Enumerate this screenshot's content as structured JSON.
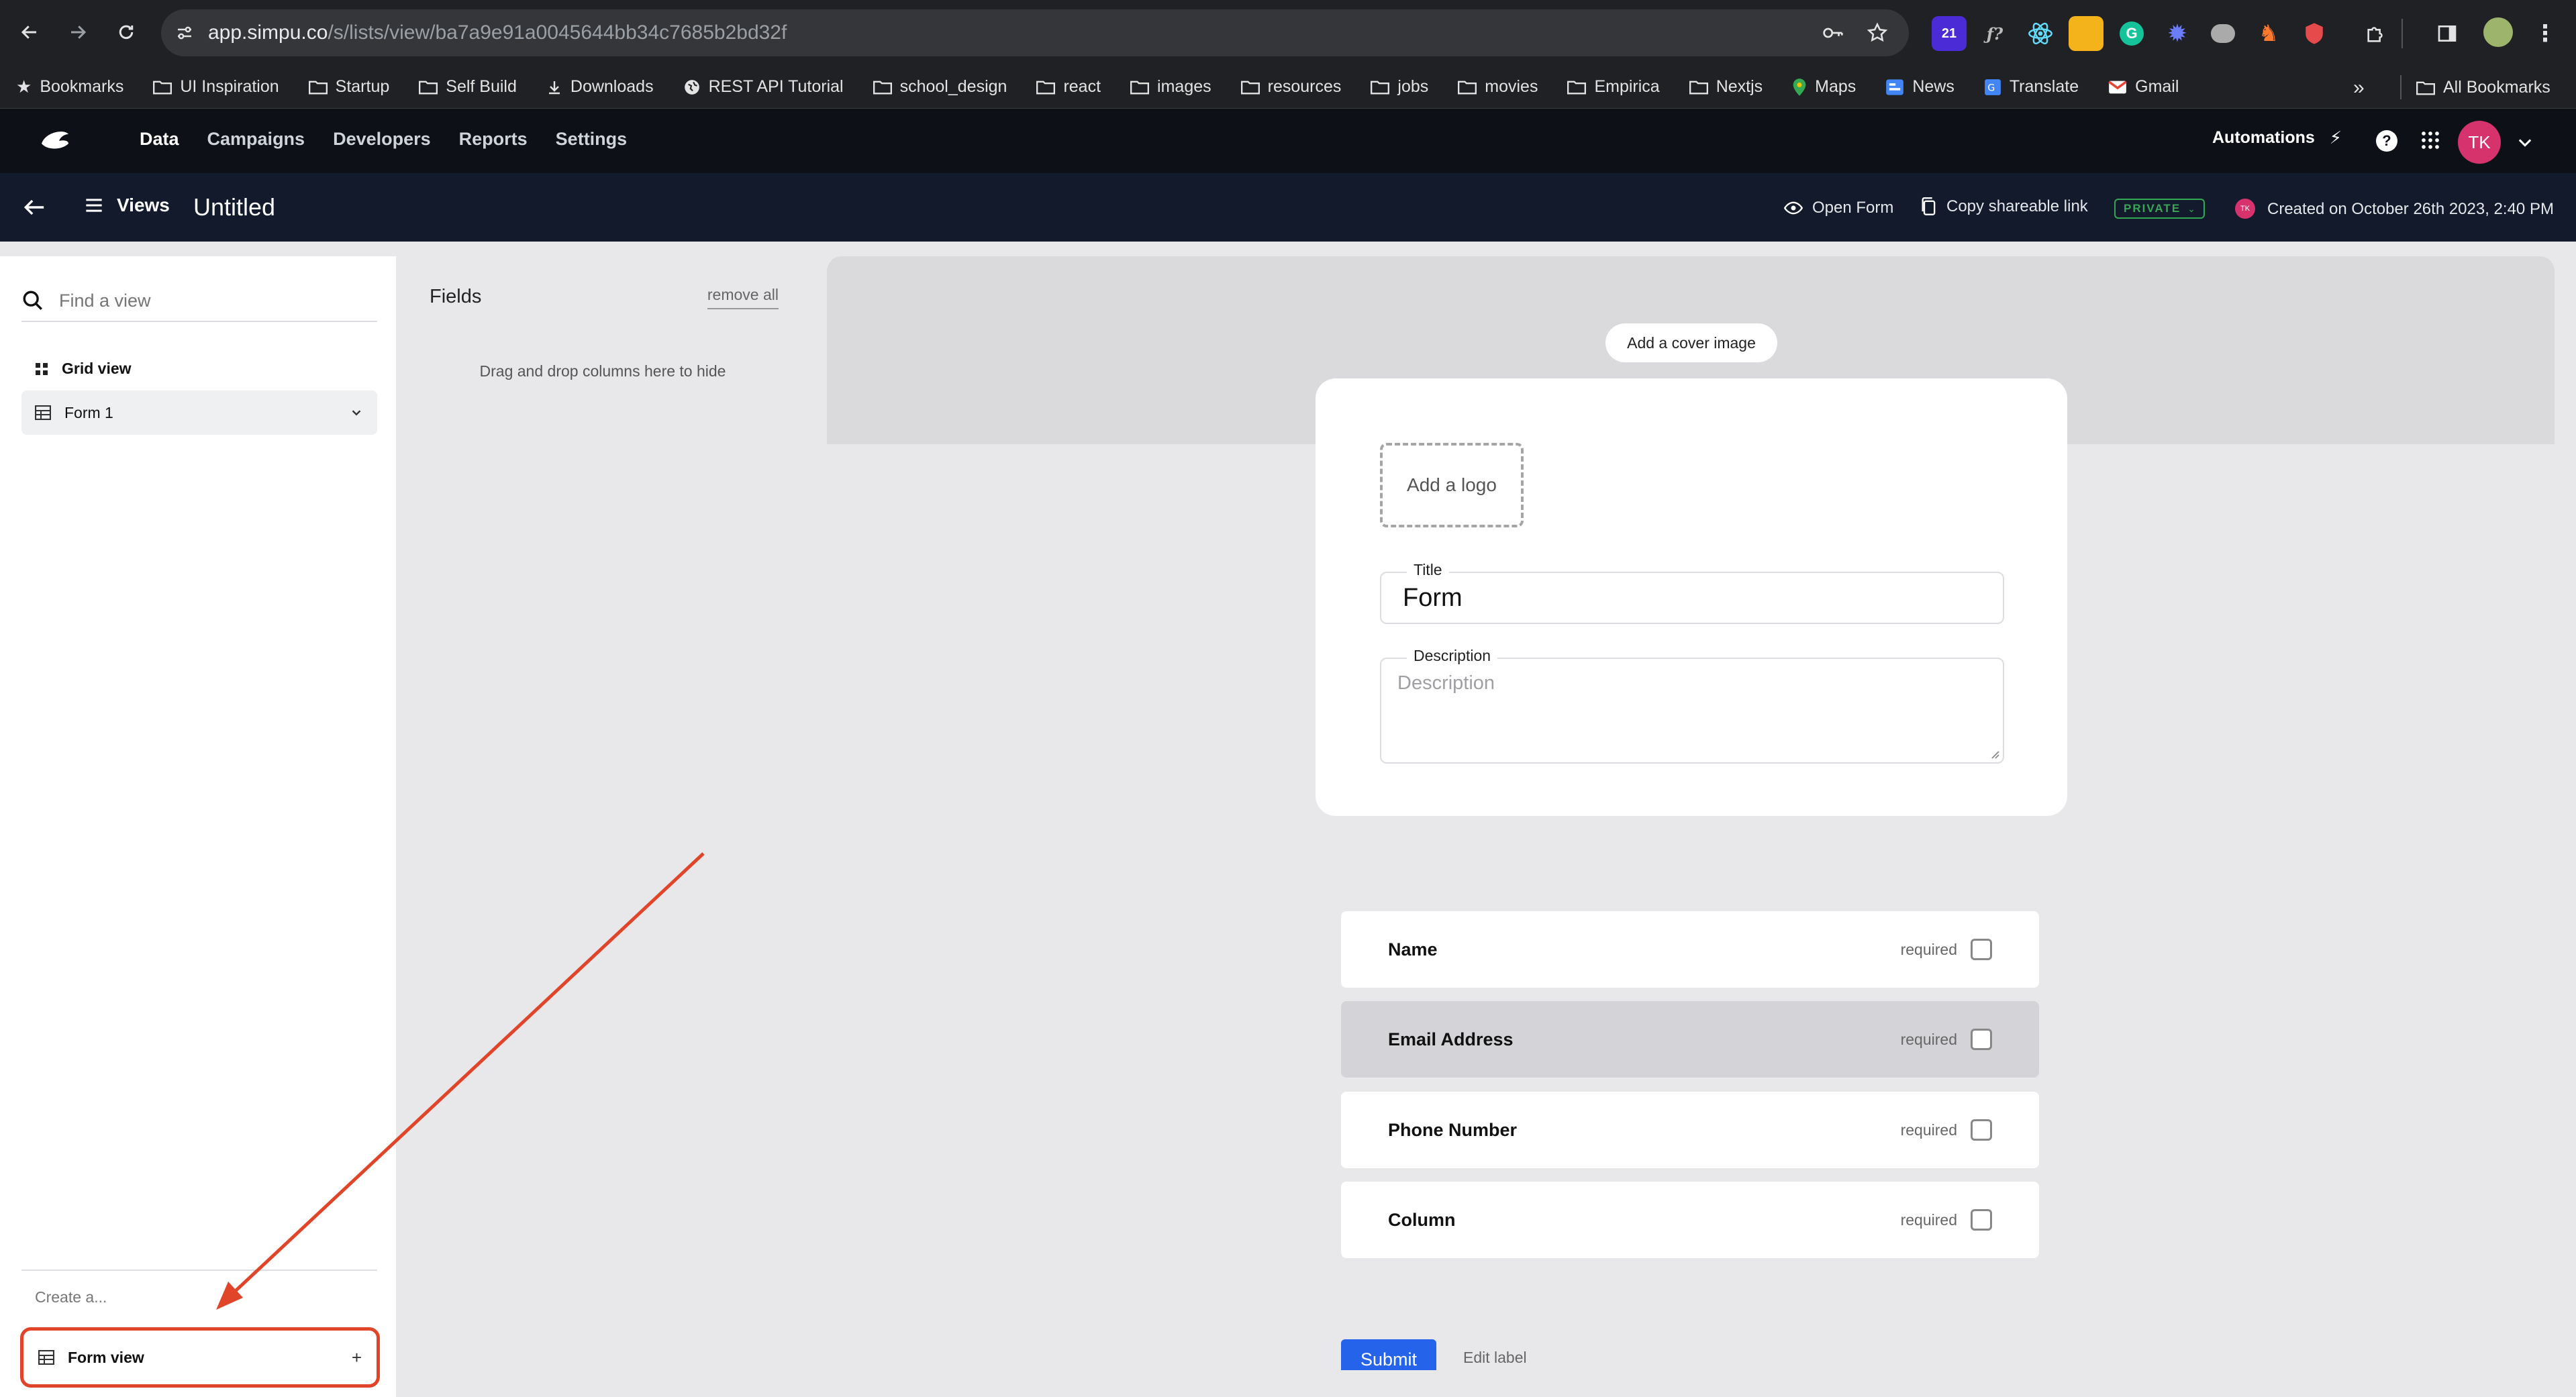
{
  "browser": {
    "url_host": "app.simpu.co",
    "url_path": "/s/lists/view/ba7a9e91a0045644bb34c7685b2bd32f",
    "extension_badge": "21",
    "bookmarks": [
      {
        "label": "Bookmarks",
        "icon": "star-icon"
      },
      {
        "label": "UI Inspiration",
        "icon": "folder-icon"
      },
      {
        "label": "Startup",
        "icon": "folder-icon"
      },
      {
        "label": "Self Build",
        "icon": "folder-icon"
      },
      {
        "label": "Downloads",
        "icon": "download-icon"
      },
      {
        "label": "REST API Tutorial",
        "icon": "globe-icon"
      },
      {
        "label": "school_design",
        "icon": "folder-icon"
      },
      {
        "label": "react",
        "icon": "folder-icon"
      },
      {
        "label": "images",
        "icon": "folder-icon"
      },
      {
        "label": "resources",
        "icon": "folder-icon"
      },
      {
        "label": "jobs",
        "icon": "folder-icon"
      },
      {
        "label": "movies",
        "icon": "folder-icon"
      },
      {
        "label": "Empirica",
        "icon": "folder-icon"
      },
      {
        "label": "Nextjs",
        "icon": "folder-icon"
      },
      {
        "label": "Maps",
        "icon": "maps-icon"
      },
      {
        "label": "News",
        "icon": "news-icon"
      },
      {
        "label": "Translate",
        "icon": "translate-icon"
      },
      {
        "label": "Gmail",
        "icon": "gmail-icon"
      }
    ],
    "all_bookmarks": "All Bookmarks"
  },
  "app": {
    "nav": [
      "Data",
      "Campaigns",
      "Developers",
      "Reports",
      "Settings"
    ],
    "automations": "Automations",
    "avatar": "TK"
  },
  "subheader": {
    "views_label": "Views",
    "title": "Untitled",
    "open_form": "Open Form",
    "copy_link": "Copy shareable link",
    "privacy": "PRIVATE",
    "avatar_small": "TK",
    "created": "Created on October 26th 2023, 2:40 PM"
  },
  "sidebar": {
    "search_placeholder": "Find a view",
    "views": [
      {
        "label": "Grid view",
        "icon": "grid-icon"
      },
      {
        "label": "Form 1",
        "icon": "table-icon"
      }
    ],
    "create_label": "Create a...",
    "create_item": "Form view"
  },
  "fields_panel": {
    "title": "Fields",
    "remove_all": "remove all",
    "hint": "Drag and drop columns here to hide"
  },
  "form": {
    "add_cover": "Add a cover image",
    "add_logo": "Add a logo",
    "title_label": "Title",
    "title_value": "Form",
    "description_label": "Description",
    "description_placeholder": "Description",
    "required_label": "required",
    "fields": [
      "Name",
      "Email Address",
      "Phone Number",
      "Column"
    ],
    "submit": "Submit",
    "edit_label": "Edit label"
  },
  "colors": {
    "accent": "#2563eb",
    "annotation": "#e0452a",
    "private_badge": "#34a853",
    "avatar": "#d6336c"
  }
}
